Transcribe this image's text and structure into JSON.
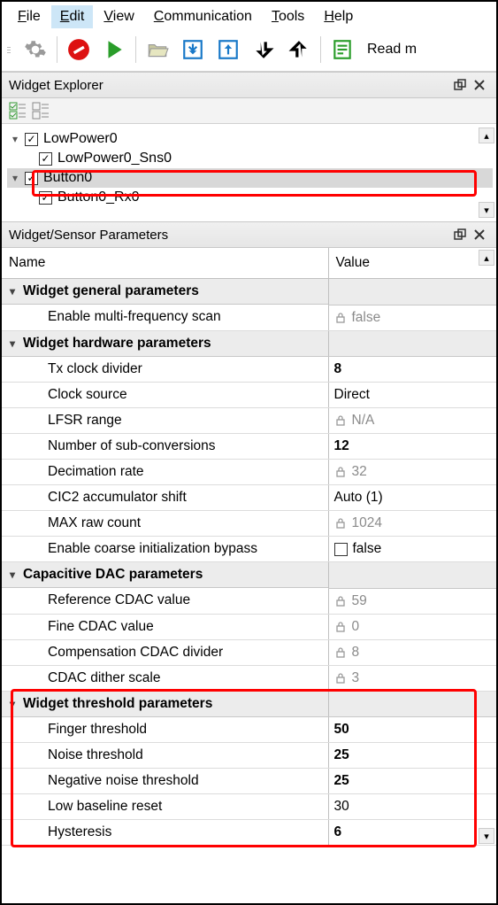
{
  "menu": {
    "file": "File",
    "edit": "Edit",
    "view": "View",
    "communication": "Communication",
    "tools": "Tools",
    "help": "Help"
  },
  "toolbar": {
    "read_label": "Read m"
  },
  "explorer": {
    "title": "Widget Explorer",
    "items": [
      {
        "label": "LowPower0",
        "children": [
          {
            "label": "LowPower0_Sns0"
          }
        ]
      },
      {
        "label": "Button0",
        "children": [
          {
            "label": "Button0_Rx0"
          }
        ]
      }
    ]
  },
  "params_panel": {
    "title": "Widget/Sensor Parameters",
    "columns": {
      "name": "Name",
      "value": "Value"
    }
  },
  "groups": [
    {
      "title": "Widget general parameters",
      "rows": [
        {
          "name": "Enable multi-frequency scan",
          "value": "false",
          "locked": true
        }
      ]
    },
    {
      "title": "Widget hardware parameters",
      "rows": [
        {
          "name": "Tx clock divider",
          "value": "8",
          "bold": true
        },
        {
          "name": "Clock source",
          "value": "Direct"
        },
        {
          "name": "LFSR range",
          "value": "N/A",
          "locked": true
        },
        {
          "name": "Number of sub-conversions",
          "value": "12",
          "bold": true
        },
        {
          "name": "Decimation rate",
          "value": "32",
          "locked": true
        },
        {
          "name": "CIC2 accumulator shift",
          "value": "Auto (1)"
        },
        {
          "name": "MAX raw count",
          "value": "1024",
          "locked": true
        },
        {
          "name": "Enable coarse initialization bypass",
          "value": "false",
          "checkbox": true
        }
      ]
    },
    {
      "title": "Capacitive DAC parameters",
      "rows": [
        {
          "name": "Reference CDAC value",
          "value": "59",
          "locked": true
        },
        {
          "name": "Fine CDAC value",
          "value": "0",
          "locked": true
        },
        {
          "name": "Compensation CDAC divider",
          "value": "8",
          "locked": true
        },
        {
          "name": "CDAC dither scale",
          "value": "3",
          "locked": true
        }
      ]
    },
    {
      "title": "Widget threshold parameters",
      "rows": [
        {
          "name": "Finger threshold",
          "value": "50",
          "bold": true
        },
        {
          "name": "Noise threshold",
          "value": "25",
          "bold": true
        },
        {
          "name": "Negative noise threshold",
          "value": "25",
          "bold": true
        },
        {
          "name": "Low baseline reset",
          "value": "30"
        },
        {
          "name": "Hysteresis",
          "value": "6",
          "bold": true
        }
      ]
    }
  ]
}
